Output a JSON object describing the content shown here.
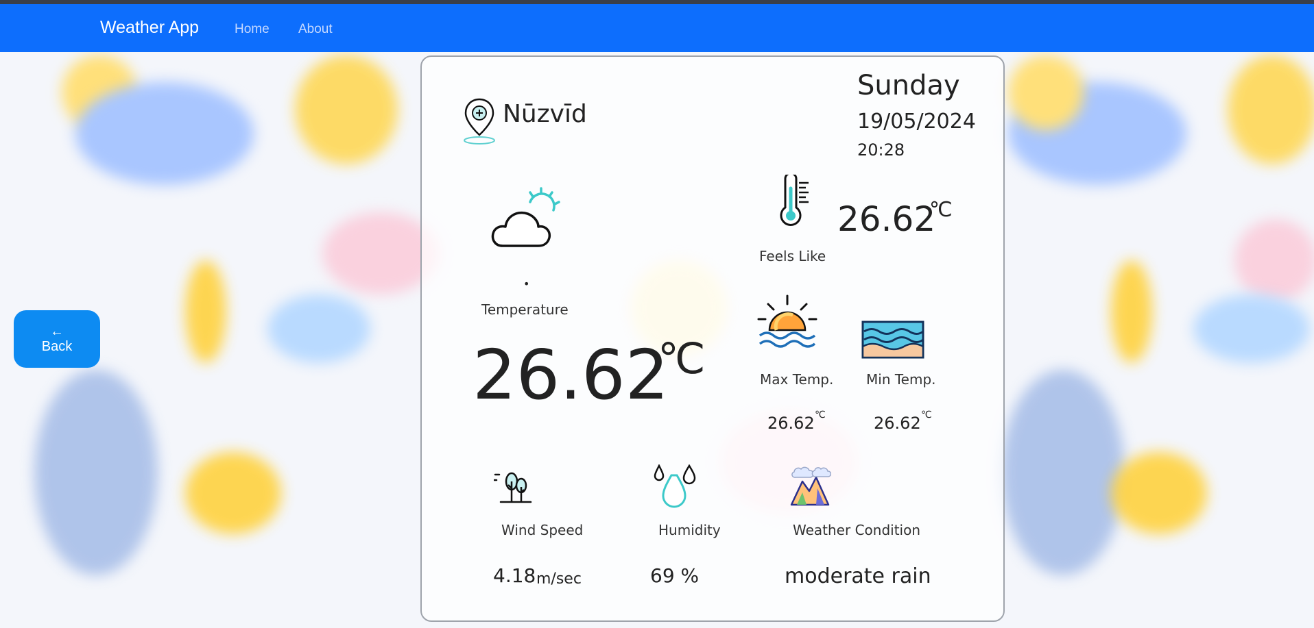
{
  "navbar": {
    "brand": "Weather App",
    "links": [
      "Home",
      "About"
    ]
  },
  "back_button": {
    "arrow": "←",
    "label": "Back"
  },
  "location": {
    "city": "Nūzvīd",
    "icon": "location-pin-icon"
  },
  "datetime": {
    "day": "Sunday",
    "date": "19/05/2024",
    "time": "20:28"
  },
  "feels_like": {
    "value": "26.62",
    "unit": "℃",
    "label": "Feels Like",
    "icon": "thermometer-icon"
  },
  "main": {
    "icon": "cloud-sun-icon",
    "dot": "•",
    "label": "Temperature",
    "value": "26.62",
    "unit": "℃"
  },
  "max_temp": {
    "label": "Max Temp.",
    "value": "26.62",
    "unit": "℃",
    "icon": "sunset-icon"
  },
  "min_temp": {
    "label": "Min Temp.",
    "value": "26.62",
    "unit": "℃",
    "icon": "sea-waves-icon"
  },
  "wind": {
    "label": "Wind Speed",
    "value": "4.18",
    "unit": "m/sec",
    "icon": "wind-trees-icon"
  },
  "humidity": {
    "label": "Humidity",
    "value": "69 %",
    "icon": "water-drops-icon"
  },
  "condition": {
    "label": "Weather Condition",
    "value": "moderate rain",
    "icon": "mountain-cloud-icon"
  },
  "colors": {
    "navbar": "#0d6efd",
    "back_button": "#0d8bf2",
    "accent_teal": "#3cc9c9"
  }
}
